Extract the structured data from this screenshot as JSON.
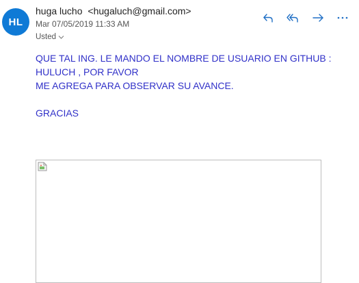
{
  "avatar": {
    "initials": "HL",
    "color": "#0f7ad6"
  },
  "header": {
    "sender_name": "huga lucho",
    "sender_email": "<hugaluch@gmail.com>",
    "date": "Mar 07/05/2019 11:33 AM",
    "recipient": "Usted"
  },
  "actions": [
    {
      "icon": "reply-icon"
    },
    {
      "icon": "reply-all-icon"
    },
    {
      "icon": "forward-icon"
    },
    {
      "icon": "more-icon"
    }
  ],
  "message": {
    "line1": "QUE TAL ING. LE MANDO EL NOMBRE DE USUARIO EN GITHUB :",
    "line2": "HULUCH , POR FAVOR",
    "line3": "ME AGREGA PARA OBSERVAR SU AVANCE.",
    "line4": "GRACIAS",
    "color": "#3030c8"
  },
  "attachment_image": {
    "state": "broken-image-icon"
  }
}
